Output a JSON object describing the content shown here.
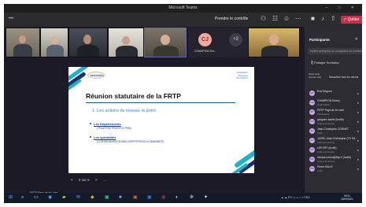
{
  "window": {
    "title": "Microsoft Teams",
    "controls": "– □ ✕"
  },
  "toolbar": {
    "more": "•••",
    "take_control": "Prendre le contrôle",
    "leave": "↗ Quitter",
    "icons": [
      "participants-icon",
      "chat-icon",
      "reactions-icon",
      "more-icon",
      "camera-icon",
      "mic-icon",
      "share-icon"
    ]
  },
  "tiles": {
    "cj_initials": "CJ",
    "cj_name": "CHAMPION Em...",
    "overflow": "+2"
  },
  "slide": {
    "logo_left": "RETRAITES",
    "logo_right": "Fédération Réseaux Territoriaux",
    "title": "Réunion statutaire de la FRTP",
    "subtitle": "1. Les actions du réseau, le point",
    "bullet1_label": "Les Départements",
    "bullet1_detail": "(TP44/TP49/TP53/TP72/TP85)",
    "bullet2_label": "Les spécialités",
    "bullet2_detail": "(CGR/SRDN/SEDCE/SNECOREP/TPRESS et SNAEMBTP)"
  },
  "slide_nav": {
    "prev": "<",
    "page": "2 sur 6",
    "next": ">",
    "extra": "…"
  },
  "presenter": "FRTP Pays de la Loire",
  "participants": {
    "title": "Participants",
    "invite_placeholder": "Invitez quelqu'un ou composez un numéro",
    "share_invite": "Partager l'invitation",
    "section": "Dans cette réunion (16)",
    "admit_all": "Désactiver tous les micros",
    "list": [
      {
        "initials": "ES",
        "name": "Eva Grignon",
        "role": "",
        "mic": "●"
      },
      {
        "initials": "CE",
        "name": "CHAMPION Emmy",
        "role": "Organisateur",
        "mic": "●"
      },
      {
        "initials": "FP",
        "name": "FRTP Pays de la Loire",
        "role": "Présentateur",
        "mic": "●"
      },
      {
        "initials": "GD",
        "name": "grégoire daniel (Invité)",
        "role": "Invité à la réunion",
        "mic": "●"
      },
      {
        "initials": "JC",
        "name": "Jean-Christophe COSNET",
        "role": "Invité",
        "mic": "●"
      },
      {
        "initials": "JO",
        "name": "JOSEL Jean-Christophe (TO 53...",
        "role": "Invité à la réunion",
        "mic": "●"
      },
      {
        "initials": "LR",
        "name": "LEFORT (Invité)",
        "role": "Invité à la réunion",
        "mic": "●"
      },
      {
        "initials": "NC",
        "name": "nicolas.colom@frtp.fr (Invité)",
        "role": "Invité à la réunion",
        "mic": "●"
      },
      {
        "initials": "PM",
        "name": "Pierre MILLE",
        "role": "Invité",
        "mic": "●"
      }
    ]
  },
  "taskbar": {
    "system": "▲ ☁ 9°C ∧ ▭ ⌁ ≡ FRA",
    "time": "09:51",
    "date": "15/03/2021"
  },
  "colors": {
    "teams_purple": "#6264a7",
    "leave_red": "#c4314b",
    "slide_teal": "#1fb1c4",
    "slide_navy": "#1d2f6f",
    "slide_title_blue": "#3d7cc9"
  }
}
